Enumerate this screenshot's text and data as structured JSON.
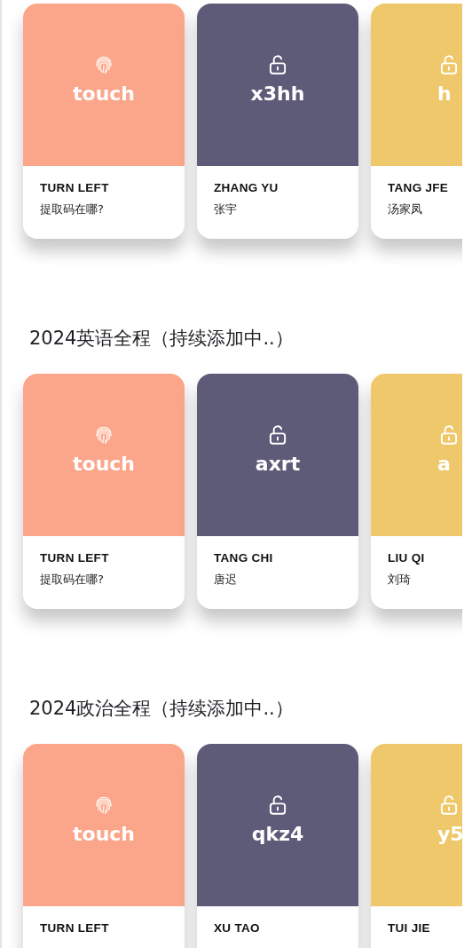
{
  "sections": [
    {
      "cards": [
        {
          "kind": "fingerprint",
          "color": "#fba68b",
          "code": "touch",
          "name": "TURN LEFT",
          "subtitle": "提取码在哪?"
        },
        {
          "kind": "lock",
          "color": "#5e5b78",
          "code": "x3hh",
          "name": "ZHANG YU",
          "subtitle": "张宇"
        },
        {
          "kind": "partial",
          "color": "#eec86a",
          "code": "h",
          "name": "TANG JFE",
          "subtitle": "汤家凤"
        }
      ]
    },
    {
      "title": "2024英语全程（持续添加中..）",
      "cards": [
        {
          "kind": "fingerprint",
          "color": "#fba68b",
          "code": "touch",
          "name": "TURN LEFT",
          "subtitle": "提取码在哪?"
        },
        {
          "kind": "lock",
          "color": "#5e5b78",
          "code": "axrt",
          "name": "TANG CHI",
          "subtitle": "唐迟"
        },
        {
          "kind": "partial",
          "color": "#eec86a",
          "code": "a",
          "name": "LIU QI",
          "subtitle": "刘琦"
        }
      ]
    },
    {
      "title": "2024政治全程（持续添加中..）",
      "cards": [
        {
          "kind": "fingerprint",
          "color": "#fba68b",
          "code": "touch",
          "name": "TURN LEFT"
        },
        {
          "kind": "lock",
          "color": "#5e5b78",
          "code": "qkz4",
          "name": "XU TAO"
        },
        {
          "kind": "partial",
          "color": "#eec86a",
          "code": "y5",
          "name": "TUI JIE"
        }
      ]
    }
  ]
}
